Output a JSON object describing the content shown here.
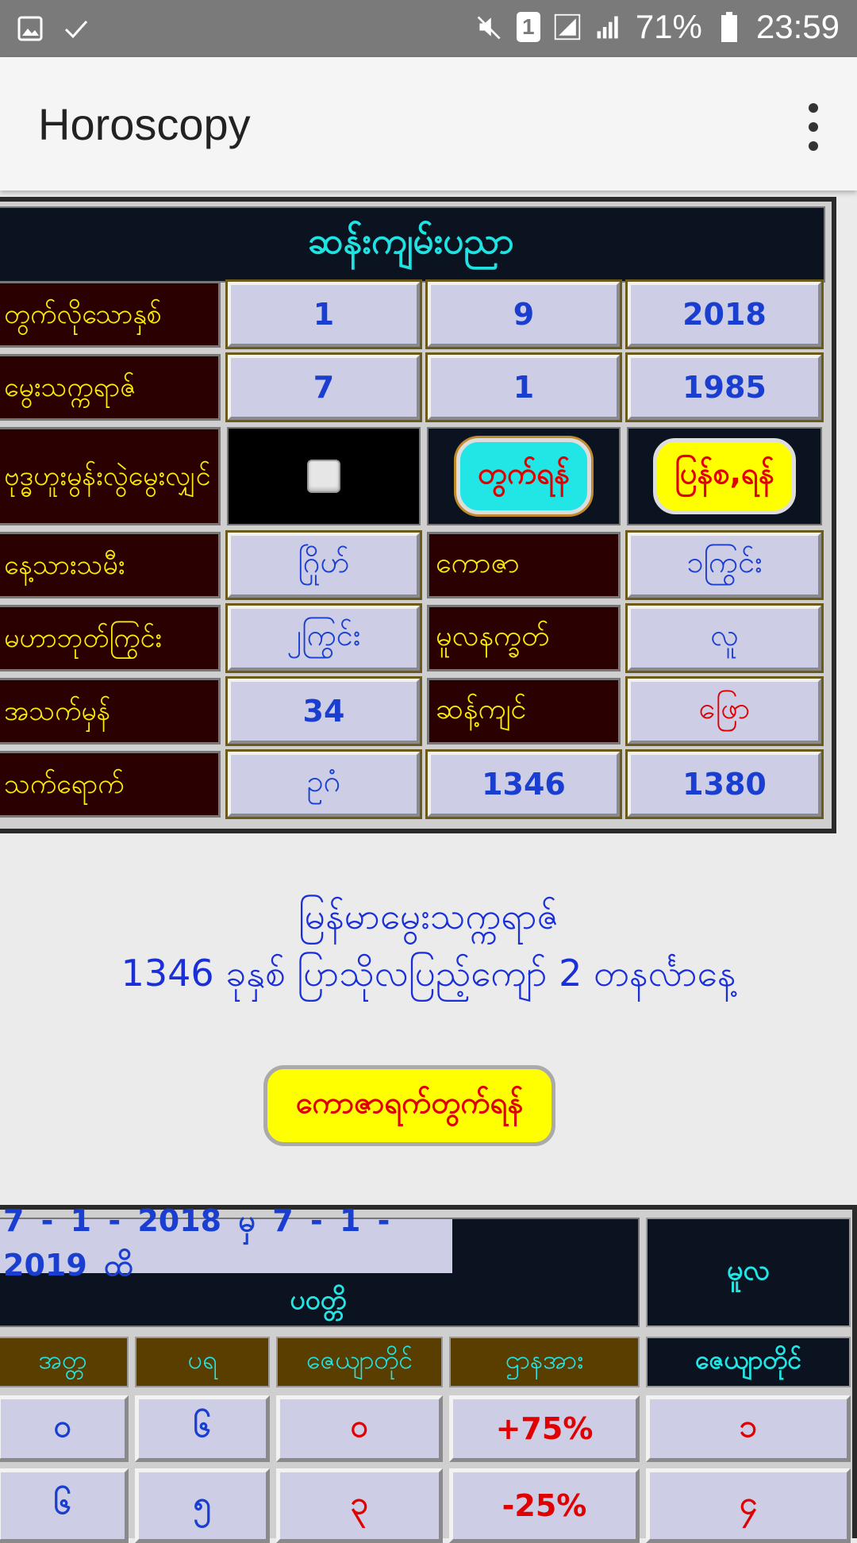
{
  "status_bar": {
    "battery": "71%",
    "time": "23:59",
    "sim_slot": "1",
    "icons": [
      "image-icon",
      "check-icon",
      "mute-icon",
      "sim-icon",
      "signal-icon",
      "battery-icon"
    ]
  },
  "app": {
    "title": "Horoscopy"
  },
  "panel": {
    "title": "ဆန်းကျမ်းပညာ",
    "rows": [
      {
        "label": "တွက်လိုသောနှစ်",
        "v1": "1",
        "v2": "9",
        "v3": "2018"
      },
      {
        "label": "မွေးသက္ကရာဇ်",
        "v1": "7",
        "v2": "1",
        "v3": "1985"
      },
      {
        "label": "ဗုဒ္ဓဟူးမွန်းလွဲမွေးလျှင်",
        "calc_button": "တွက်ရန်",
        "reset_button": "ပြန်စ,ရန်"
      },
      {
        "label": "နေ့သားသမီး",
        "v1": "ဂြိုဟ်",
        "mid_label": "ကောဇာ",
        "v3": "၁ကြွင်း"
      },
      {
        "label": "မဟာဘုတ်ကြွင်း",
        "v1": "၂ကြွင်း",
        "mid_label": "မူလနက္ခတ်",
        "v3": "လူ"
      },
      {
        "label": "အသက်မှန်",
        "v1": "34",
        "mid_label": "ဆန့်ကျင်",
        "v3": "ဖြော"
      },
      {
        "label": "သက်ရောက်",
        "v1": "ဥဂံ",
        "v2": "1346",
        "v3": "1380"
      }
    ]
  },
  "myanmar_date": {
    "line1": "မြန်မာမွေးသက္ကရာဇ်",
    "line2": "1346 ခုနှစ် ပြာသိုလပြည့်ကျော် 2 တနင်္လာနေ့"
  },
  "kawza_button": "ကောဇာရက်တွက်ရန်",
  "table2": {
    "date_range": "7 - 1 - 2018   မှ   7 - 1 - 2019   ထိ",
    "sub_title": "ပဝတ္တိ",
    "mula": "မူလ",
    "headers": [
      "အတ္တ",
      "ပရ",
      "ဇေယျာတိုင်",
      "ဌာနအား",
      "ဇေယျာတိုင်"
    ],
    "rows": [
      [
        "၀",
        "၆",
        "၀",
        "+75%",
        "၁"
      ],
      [
        "၆",
        "၅",
        "၃",
        "-25%",
        "၄"
      ]
    ]
  }
}
